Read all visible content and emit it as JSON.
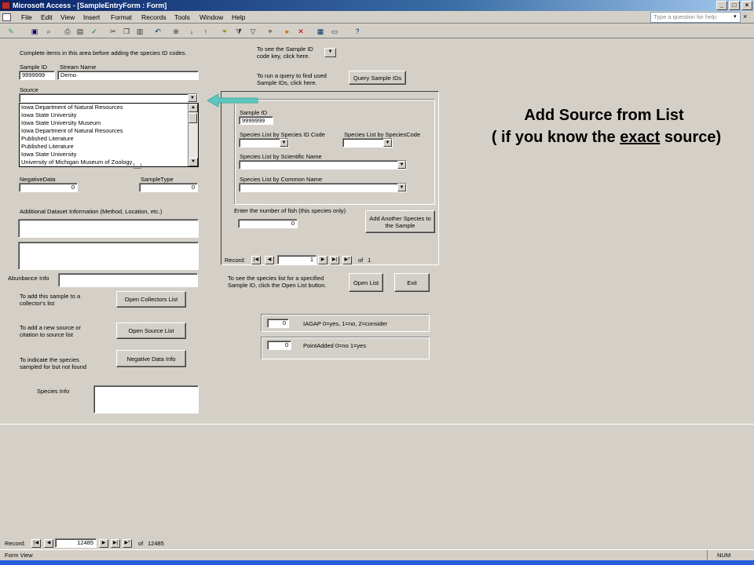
{
  "window": {
    "title": "Microsoft Access - [SampleEntryForm : Form]"
  },
  "menu": [
    "File",
    "Edit",
    "View",
    "Insert",
    "Format",
    "Records",
    "Tools",
    "Window",
    "Help"
  ],
  "help_box": {
    "placeholder": "Type a question for help"
  },
  "form": {
    "instruction": "Complete items in this area before adding the species ID codes.",
    "sample_id_label": "Sample ID",
    "sample_id_value": "9999999",
    "stream_name_label": "Stream Name",
    "stream_name_value": "Demo",
    "source_label": "Source",
    "source_options": [
      "Iowa Department of Natural Resources",
      "Iowa State University",
      "Iowa State University Museum",
      "Iowa Department of Natural Resources",
      "Published Literature",
      "Published Literature",
      "Iowa State University",
      "University of Michigan Museum of Zoology"
    ],
    "negative_data_label": "NegativeData",
    "negative_data_value": "0",
    "sample_type_label": "SampleType",
    "sample_type_value": "0",
    "additional_info_label": "Additional Dataset Information (Method, Location, etc.)",
    "abundance_label": "Abunbance Info",
    "collectors_text": "To add this sample to a collector's list",
    "collectors_button": "Open Collectors List",
    "source_text": "To add a new source or citation to source list",
    "source_button": "Open Source List",
    "negative_text": "To indicate the species sampled for but not found",
    "negative_button": "Negative Data Info",
    "species_info_label": "Species Info"
  },
  "right": {
    "key_text": "To see the Sample ID code key, click here.",
    "query_text": "To run a query to find used Sample IDs, click here.",
    "query_button": "Query Sample IDs",
    "sub_sample_id_label": "Sample ID",
    "sub_sample_id_value": "9999999",
    "species_by_id_label": "Species List by Species ID Code",
    "species_by_code_label": "Species List by SpeciesCode",
    "species_by_sci_label": "Species List by Scientific Name",
    "species_by_common_label": "Species List by Common Name",
    "fish_count_label": "Enter the number of fish (this species only)",
    "fish_count_value": "0",
    "add_species_button": "Add Another Species to the Sample",
    "record_label": "Record:",
    "record_value": "1",
    "record_of": "of",
    "record_total": "1",
    "open_list_text": "To see the species list for a specified Sample ID, click the Open List button.",
    "open_list_button": "Open List",
    "exit_button": "Exit",
    "iagap_value": "0",
    "iagap_label": "IAGAP  0=yes, 1=no, 2=consider",
    "point_value": "0",
    "point_label": "PointAdded 0=no 1=yes"
  },
  "callout": {
    "line1": "Add Source from List",
    "line2_prefix": "( if you know the ",
    "line2_emph": "exact",
    "line2_suffix": " source)",
    "arrow_color": "#5bc8c0"
  },
  "nav": {
    "record_label": "Record:",
    "record_value": "12485",
    "of": "of",
    "total": "12485"
  },
  "status": {
    "view": "Form View",
    "num": "NUM"
  }
}
